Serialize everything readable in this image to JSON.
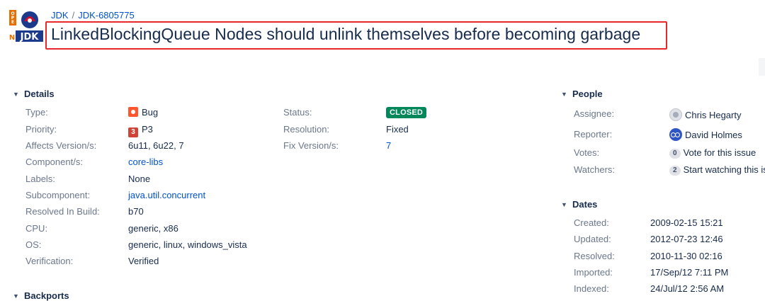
{
  "breadcrumb": {
    "project": "JDK",
    "separator": "/",
    "issue_key": "JDK-6805775"
  },
  "title": "LinkedBlockingQueue Nodes should unlink themselves before becoming garbage",
  "details": {
    "heading": "Details",
    "type": {
      "label": "Type:",
      "value": "Bug"
    },
    "priority": {
      "label": "Priority:",
      "icon_text": "3",
      "value": "P3"
    },
    "affects_versions": {
      "label": "Affects Version/s:",
      "value": "6u11, 6u22, 7"
    },
    "components": {
      "label": "Component/s:",
      "value": "core-libs"
    },
    "labels": {
      "label": "Labels:",
      "value": "None"
    },
    "subcomponent": {
      "label": "Subcomponent:",
      "value": "java.util.concurrent"
    },
    "resolved_in_build": {
      "label": "Resolved In Build:",
      "value": "b70"
    },
    "cpu": {
      "label": "CPU:",
      "value": "generic, x86"
    },
    "os": {
      "label": "OS:",
      "value": "generic, linux, windows_vista"
    },
    "verification": {
      "label": "Verification:",
      "value": "Verified"
    },
    "status": {
      "label": "Status:",
      "value": "CLOSED"
    },
    "resolution": {
      "label": "Resolution:",
      "value": "Fixed"
    },
    "fix_versions": {
      "label": "Fix Version/s:",
      "value": "7"
    }
  },
  "backports": {
    "heading": "Backports"
  },
  "people": {
    "heading": "People",
    "assignee": {
      "label": "Assignee:",
      "value": "Chris Hegarty"
    },
    "reporter": {
      "label": "Reporter:",
      "value": "David Holmes"
    },
    "votes": {
      "label": "Votes:",
      "count": "0",
      "action": "Vote for this issue"
    },
    "watchers": {
      "label": "Watchers:",
      "count": "2",
      "action": "Start watching this issue"
    }
  },
  "dates": {
    "heading": "Dates",
    "created": {
      "label": "Created:",
      "value": "2009-02-15 15:21"
    },
    "updated": {
      "label": "Updated:",
      "value": "2012-07-23 12:46"
    },
    "resolved": {
      "label": "Resolved:",
      "value": "2010-11-30 02:16"
    },
    "imported": {
      "label": "Imported:",
      "value": "17/Sep/12 7:11 PM"
    },
    "indexed": {
      "label": "Indexed:",
      "value": "24/Jul/12 2:56 AM"
    }
  },
  "colors": {
    "link": "#0052cc",
    "status_closed": "#00875a",
    "highlight_border": "#e8282b",
    "bug": "#ff5630",
    "priority_p3": "#d04437"
  },
  "icons": [
    "openjdk-logo",
    "bug-icon",
    "priority-p3-icon",
    "chevron-down-icon",
    "avatar-icon"
  ]
}
